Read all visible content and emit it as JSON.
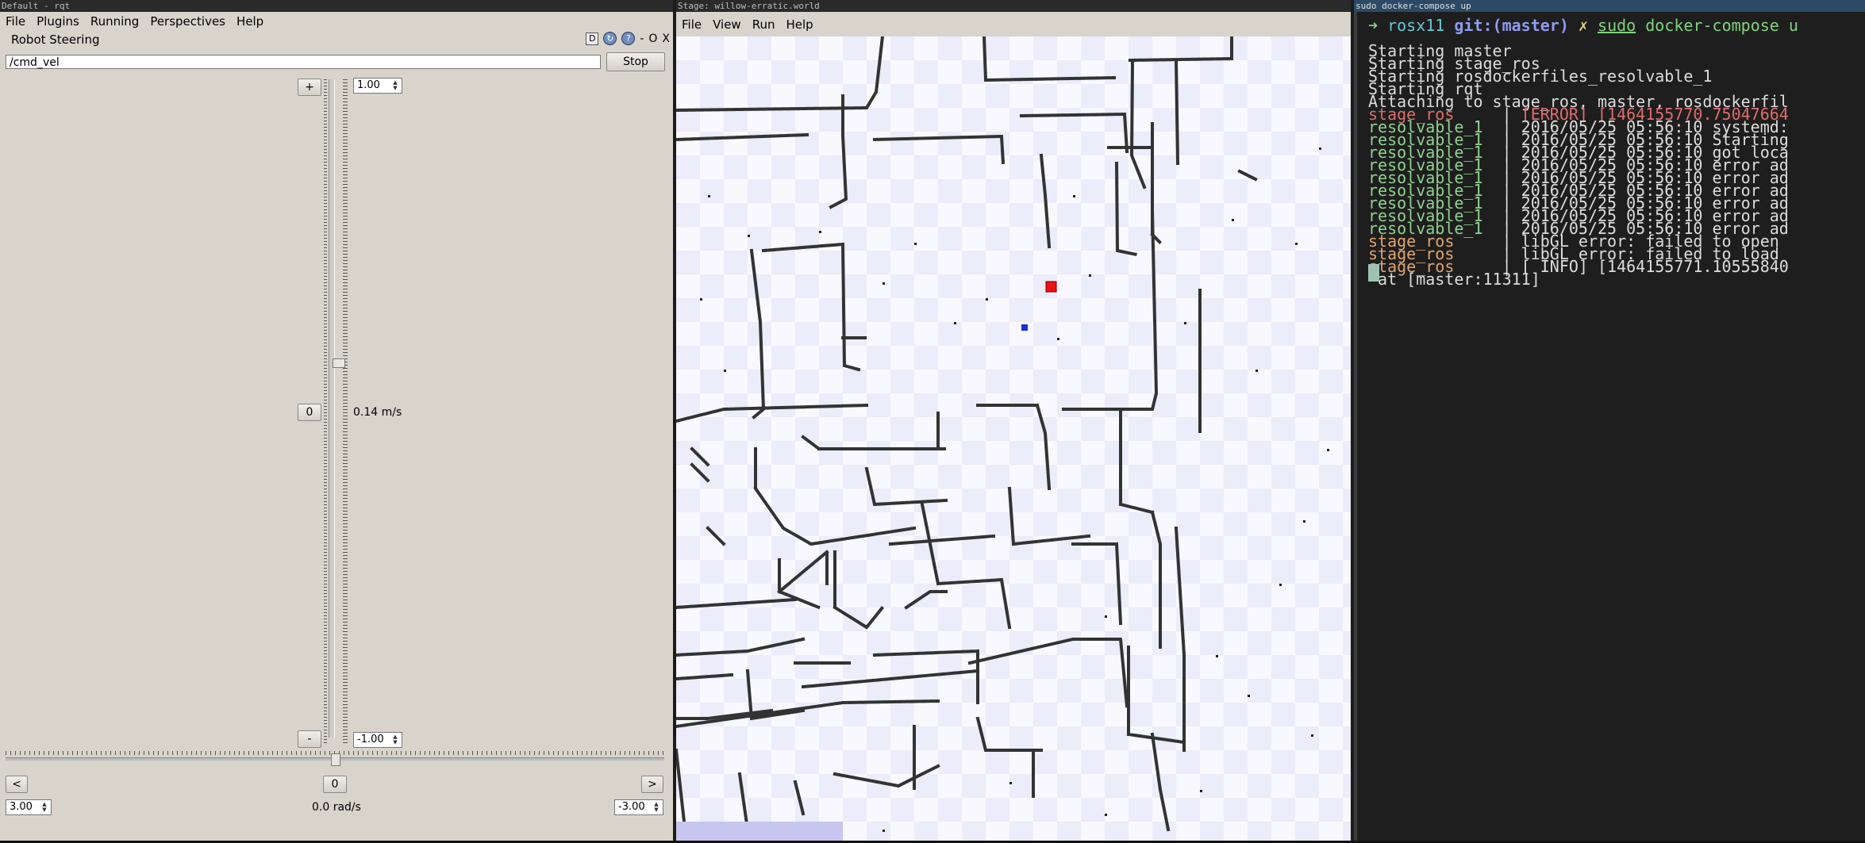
{
  "rqt": {
    "window_title": "Default - rqt",
    "menu": [
      "File",
      "Plugins",
      "Running",
      "Perspectives",
      "Help"
    ],
    "plugin_title": "Robot Steering",
    "plugin_controls": [
      "D",
      "?",
      "-",
      "O",
      "X"
    ],
    "topic_value": "/cmd_vel",
    "stop_label": "Stop",
    "plus_label": "+",
    "zero_label": "0",
    "minus_label": "-",
    "max_linear": "1.00",
    "min_linear": "-1.00",
    "linear_value": "0.14 m/s",
    "linear_slider_value": 0.14,
    "left_label": "<",
    "right_label": ">",
    "zero_angular_label": "0",
    "max_angular": "3.00",
    "min_angular": "-3.00",
    "angular_value": "0.0 rad/s",
    "angular_slider_value": 0.0
  },
  "stage": {
    "window_title": "Stage: willow-erratic.world",
    "menu": [
      "File",
      "View",
      "Run",
      "Help"
    ]
  },
  "terminal": {
    "window_title": "sudo docker-compose up",
    "prompt": {
      "arrow": "➜",
      "dir": "rosx11",
      "git": "git:(master)",
      "mark": "✗",
      "cmd_sudo": "sudo",
      "cmd_rest": "docker-compose u"
    },
    "lines": [
      {
        "prefix": "",
        "sep": "",
        "text": "Starting master",
        "color": "#dcdcdc"
      },
      {
        "prefix": "",
        "sep": "",
        "text": "Starting stage_ros",
        "color": "#dcdcdc"
      },
      {
        "prefix": "",
        "sep": "",
        "text": "Starting rosdockerfiles_resolvable_1",
        "color": "#dcdcdc"
      },
      {
        "prefix": "",
        "sep": "",
        "text": "Starting rqt",
        "color": "#dcdcdc"
      },
      {
        "prefix": "",
        "sep": "",
        "text": "Attaching to stage_ros, master, rosdockerfil",
        "color": "#dcdcdc"
      },
      {
        "prefix": "stage_ros     ",
        "sep": "| ",
        "text": "[ERROR] [1464155770.75047664",
        "color": "#e06c6c",
        "textcolor": "#e06c6c"
      },
      {
        "prefix": "resolvable_1  ",
        "sep": "| ",
        "text": "2016/05/25 05:56:10 systemd:",
        "color": "#8fd18f"
      },
      {
        "prefix": "resolvable_1  ",
        "sep": "| ",
        "text": "2016/05/25 05:56:10 Starting",
        "color": "#8fd18f"
      },
      {
        "prefix": "resolvable_1  ",
        "sep": "| ",
        "text": "2016/05/25 05:56:10 got loca",
        "color": "#8fd18f"
      },
      {
        "prefix": "resolvable_1  ",
        "sep": "| ",
        "text": "2016/05/25 05:56:10 error ad",
        "color": "#8fd18f"
      },
      {
        "prefix": "resolvable_1  ",
        "sep": "| ",
        "text": "2016/05/25 05:56:10 error ad",
        "color": "#8fd18f"
      },
      {
        "prefix": "resolvable_1  ",
        "sep": "| ",
        "text": "2016/05/25 05:56:10 error ad",
        "color": "#8fd18f"
      },
      {
        "prefix": "resolvable_1  ",
        "sep": "| ",
        "text": "2016/05/25 05:56:10 error ad",
        "color": "#8fd18f"
      },
      {
        "prefix": "resolvable_1  ",
        "sep": "| ",
        "text": "2016/05/25 05:56:10 error ad",
        "color": "#8fd18f"
      },
      {
        "prefix": "resolvable_1  ",
        "sep": "| ",
        "text": "2016/05/25 05:56:10 error ad",
        "color": "#8fd18f"
      },
      {
        "prefix": "stage_ros     ",
        "sep": "| ",
        "text": "libGL error: failed to open",
        "color": "#e0a36c"
      },
      {
        "prefix": "stage_ros     ",
        "sep": "| ",
        "text": "libGL error: failed to load",
        "color": "#e0a36c"
      },
      {
        "prefix": "stage_ros     ",
        "sep": "| ",
        "text": "[ INFO] [1464155771.10555840",
        "color": "#e0a36c"
      },
      {
        "prefix": "",
        "sep": "",
        "text": " at [master:11311]",
        "color": "#dcdcdc"
      }
    ]
  },
  "colors": {
    "robot_red": "#ee1111",
    "robot_blue": "#1a2fd0"
  }
}
